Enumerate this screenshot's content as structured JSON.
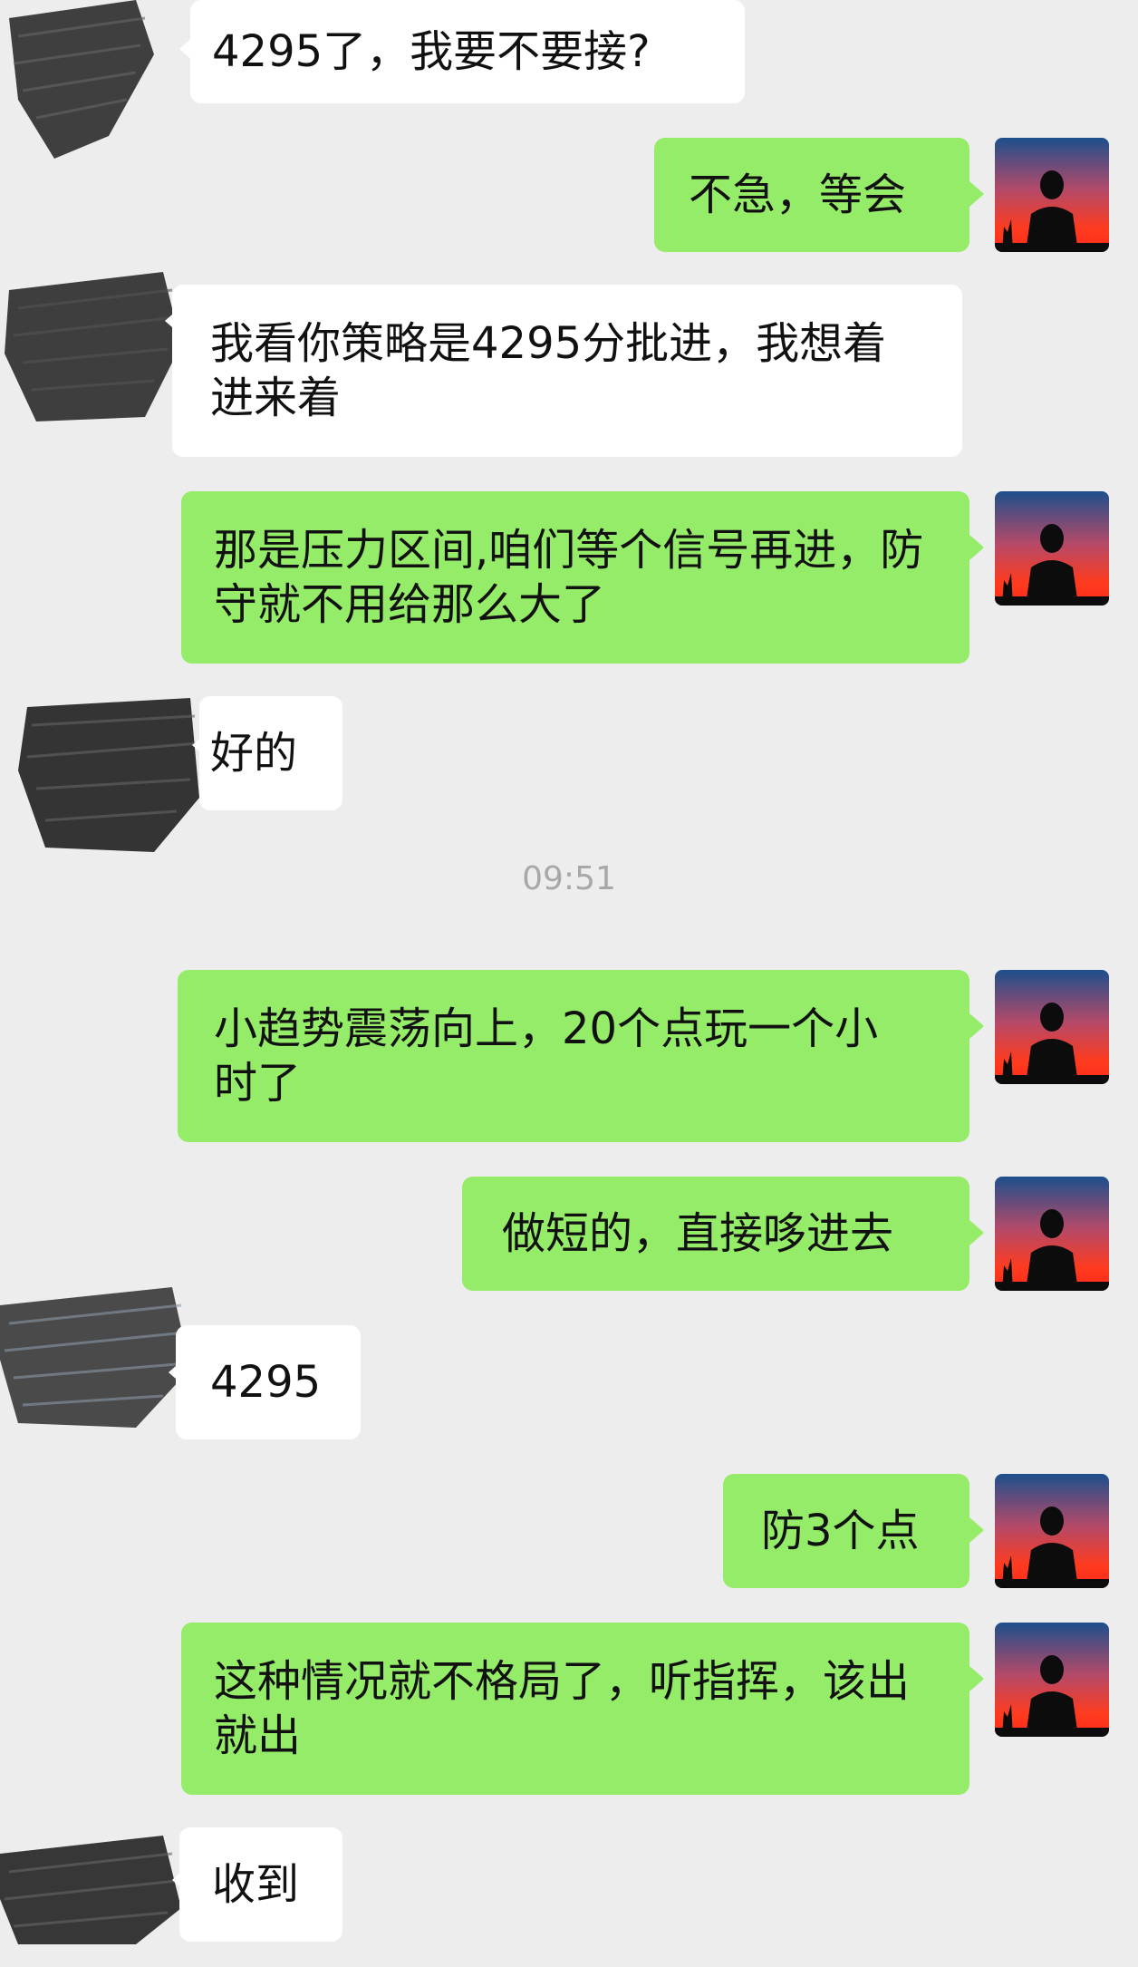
{
  "timestamp": "09:51",
  "messages": [
    {
      "side": "in",
      "text": "4295了，我要不要接?"
    },
    {
      "side": "out",
      "text": "不急，等会"
    },
    {
      "side": "in",
      "text": "我看你策略是4295分批进，我想着进来着"
    },
    {
      "side": "out",
      "text": "那是压力区间,咱们等个信号再进，防守就不用给那么大了"
    },
    {
      "side": "in",
      "text": "好的"
    },
    {
      "side": "out",
      "text": "小趋势震荡向上，20个点玩一个小时了"
    },
    {
      "side": "out",
      "text": "做短的，直接哆进去"
    },
    {
      "side": "in",
      "text": "4295"
    },
    {
      "side": "out",
      "text": "防3个点"
    },
    {
      "side": "out",
      "text": "这种情况就不格局了，听指挥，该出就出"
    },
    {
      "side": "in",
      "text": "收到"
    }
  ],
  "colors": {
    "background": "#ededed",
    "bubble_out": "#95ec69",
    "bubble_in": "#ffffff",
    "timestamp": "#a8a8a8"
  },
  "icons": {
    "self_avatar": "sunset-silhouette-avatar",
    "contact_avatar": "scribbled-out-avatar"
  }
}
